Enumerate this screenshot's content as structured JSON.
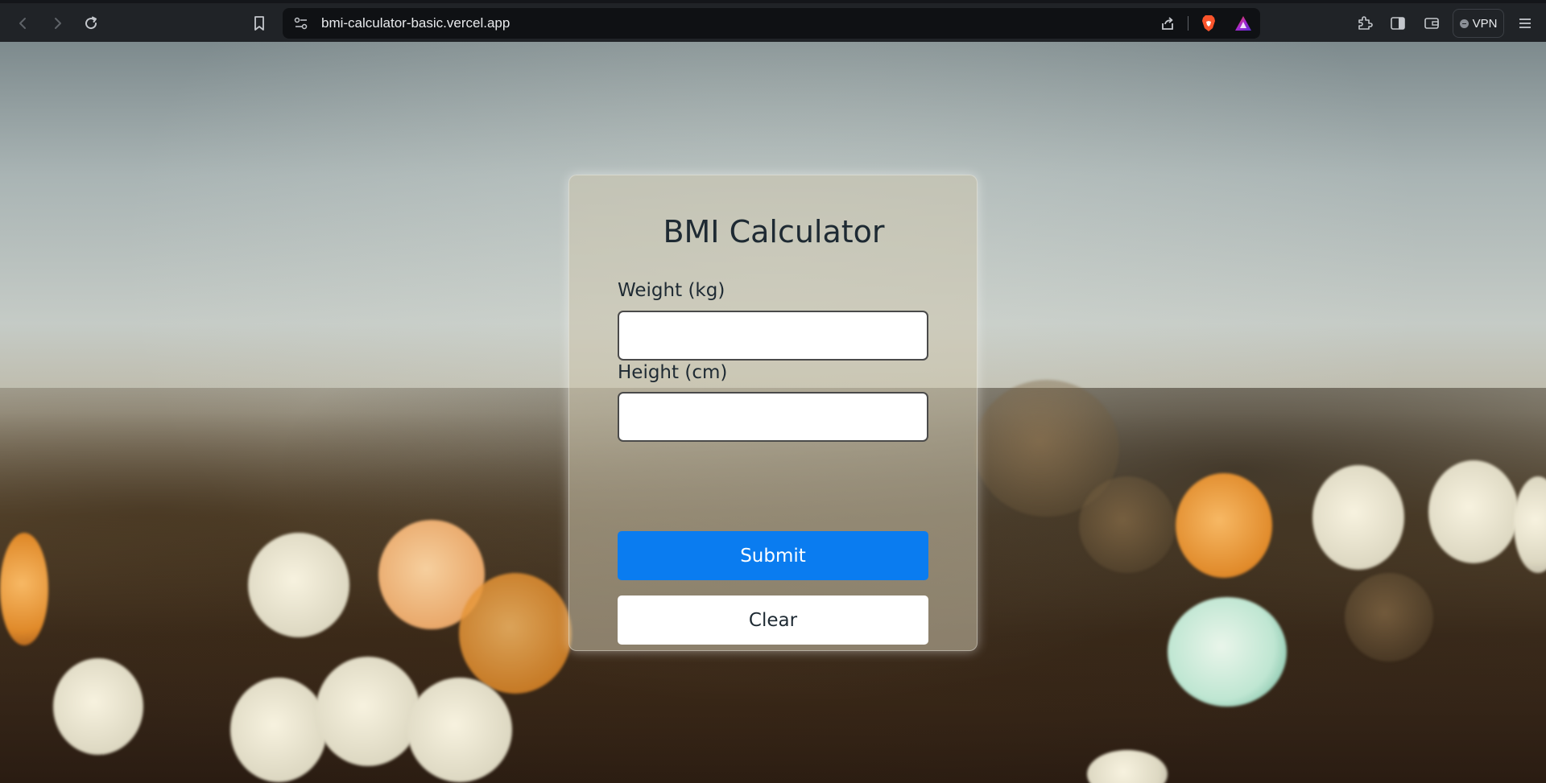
{
  "browser": {
    "url": "bmi-calculator-basic.vercel.app",
    "vpn_label": "VPN",
    "icons": {
      "back": "arrow-left-icon",
      "forward": "arrow-right-icon",
      "reload": "reload-icon",
      "bookmark": "bookmark-icon",
      "site_info": "site-settings-icon",
      "share": "share-icon",
      "brave_shields": "brave-lion-icon",
      "brave_rewards": "brave-rewards-triangle-icon",
      "extensions": "puzzle-icon",
      "sidebar": "sidebar-icon",
      "wallet": "wallet-icon",
      "menu": "hamburger-menu-icon"
    },
    "colors": {
      "toolbar": "#202327",
      "urlbar": "#0f1114",
      "brave_orange": "#fb542b"
    }
  },
  "form": {
    "title": "BMI Calculator",
    "weight": {
      "label": "Weight (kg)",
      "value": "",
      "placeholder": ""
    },
    "height": {
      "label": "Height (cm)",
      "value": "",
      "placeholder": ""
    },
    "submit_label": "Submit",
    "clear_label": "Clear",
    "colors": {
      "submit_bg": "#0a7cf0",
      "text": "#1e2a33"
    }
  }
}
